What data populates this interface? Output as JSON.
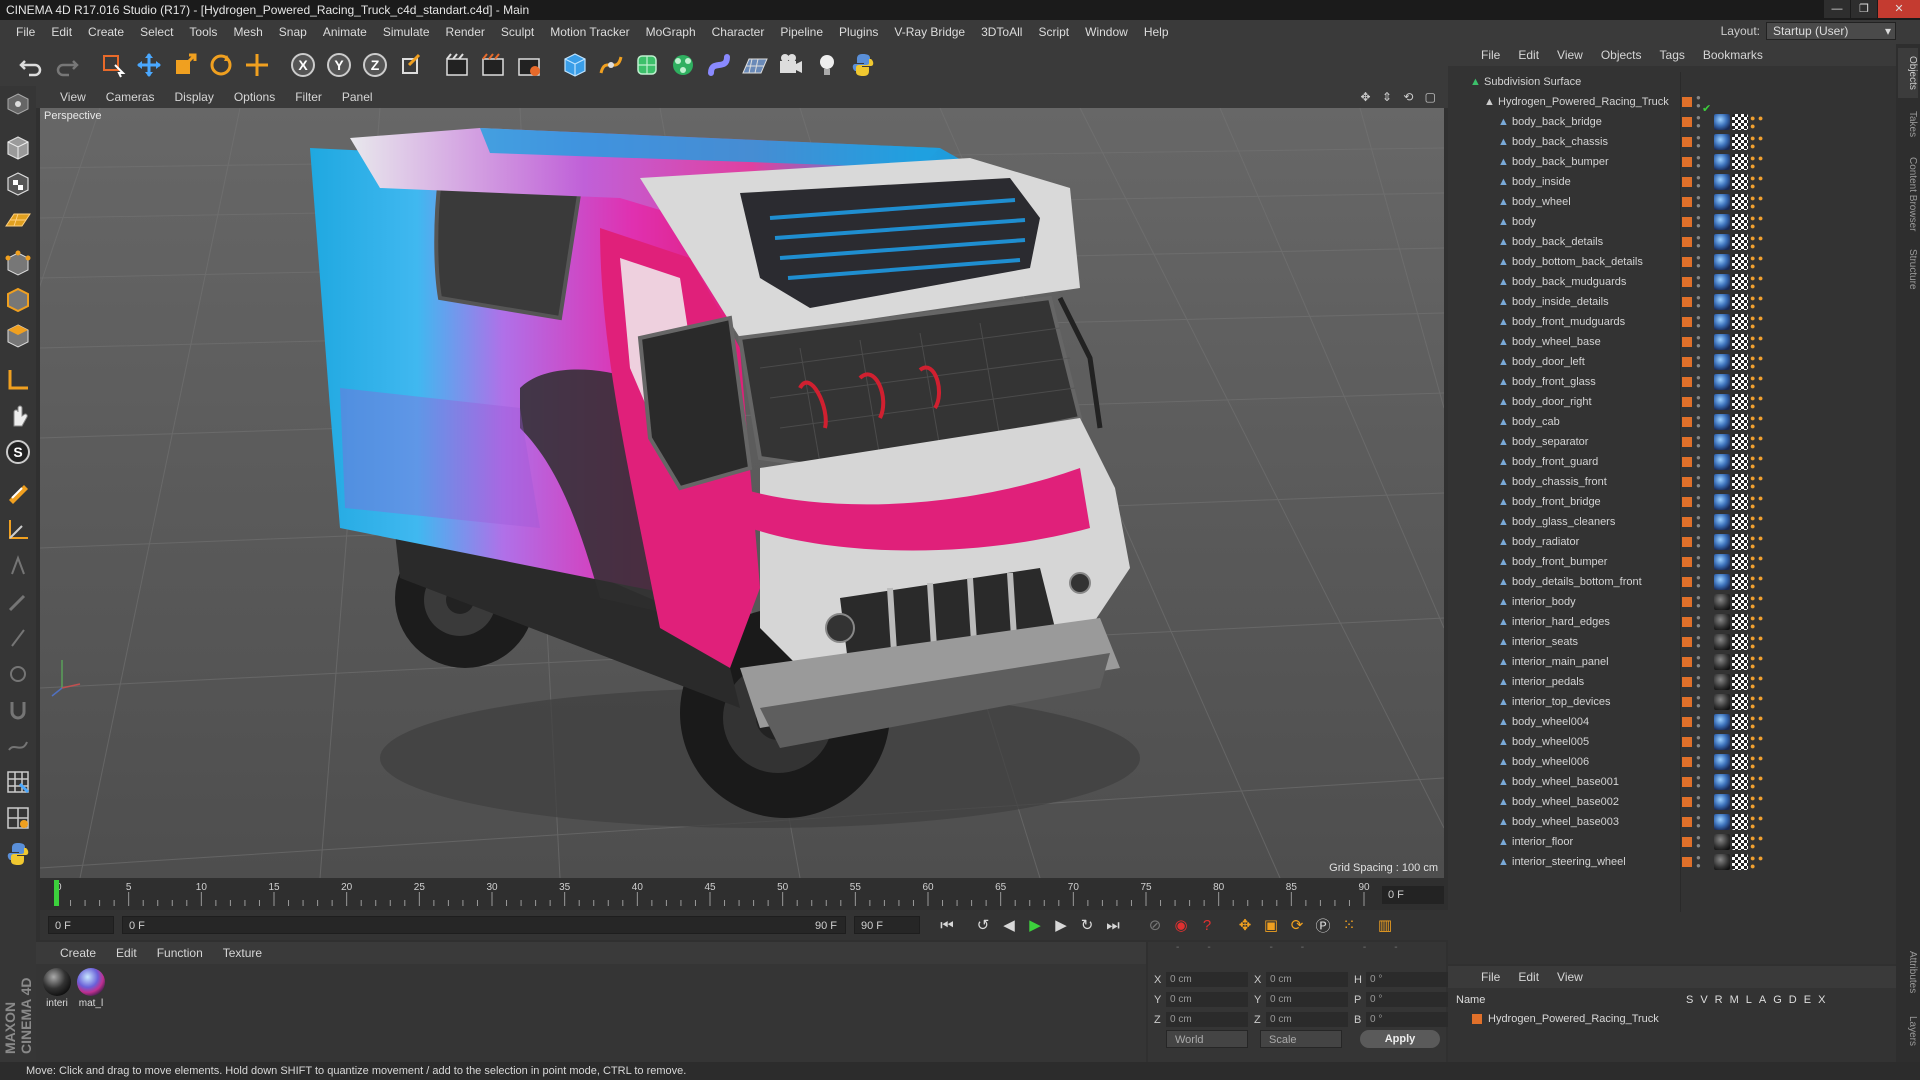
{
  "app": {
    "title": "CINEMA 4D R17.016 Studio (R17) - [Hydrogen_Powered_Racing_Truck_c4d_standart.c4d] - Main"
  },
  "menu": [
    "File",
    "Edit",
    "Create",
    "Select",
    "Tools",
    "Mesh",
    "Snap",
    "Animate",
    "Simulate",
    "Render",
    "Sculpt",
    "Motion Tracker",
    "MoGraph",
    "Character",
    "Pipeline",
    "Plugins",
    "V-Ray Bridge",
    "3DToAll",
    "Script",
    "Window",
    "Help"
  ],
  "layout": {
    "label": "Layout:",
    "value": "Startup (User)"
  },
  "viewport": {
    "menu": [
      "View",
      "Cameras",
      "Display",
      "Options",
      "Filter",
      "Panel"
    ],
    "label": "Perspective",
    "grid_spacing": "Grid Spacing : 100 cm"
  },
  "timeline": {
    "ticks": [
      "0",
      "5",
      "10",
      "15",
      "20",
      "25",
      "30",
      "35",
      "40",
      "45",
      "50",
      "55",
      "60",
      "65",
      "70",
      "75",
      "80",
      "85",
      "90"
    ],
    "end_frame_display": "0 F"
  },
  "transport": {
    "current": "0 F",
    "range_start": "0 F",
    "range_end": "90 F",
    "max": "90 F"
  },
  "materials": {
    "menu": [
      "Create",
      "Edit",
      "Function",
      "Texture"
    ],
    "items": [
      {
        "label": "interi"
      },
      {
        "label": "mat_l"
      }
    ]
  },
  "coords": {
    "header": "-- -- --",
    "rows": [
      {
        "a": "X",
        "av": "0 cm",
        "b": "X",
        "bv": "0 cm",
        "c": "H",
        "cv": "0 °"
      },
      {
        "a": "Y",
        "av": "0 cm",
        "b": "Y",
        "bv": "0 cm",
        "c": "P",
        "cv": "0 °"
      },
      {
        "a": "Z",
        "av": "0 cm",
        "b": "Z",
        "bv": "0 cm",
        "c": "B",
        "cv": "0 °"
      }
    ],
    "space": "World",
    "mode": "Scale",
    "apply": "Apply"
  },
  "status": "Move: Click and drag to move elements. Hold down SHIFT to quantize movement / add to the selection in point mode, CTRL to remove.",
  "objects": {
    "menu": [
      "File",
      "Edit",
      "View",
      "Objects",
      "Tags",
      "Bookmarks"
    ],
    "root": "Subdivision Surface",
    "group": "Hydrogen_Powered_Racing_Truck",
    "children": [
      {
        "name": "body_back_bridge",
        "mat": "mat1"
      },
      {
        "name": "body_back_chassis",
        "mat": "mat1"
      },
      {
        "name": "body_back_bumper",
        "mat": "mat1"
      },
      {
        "name": "body_inside",
        "mat": "mat1"
      },
      {
        "name": "body_wheel",
        "mat": "mat1"
      },
      {
        "name": "body",
        "mat": "mat1"
      },
      {
        "name": "body_back_details",
        "mat": "mat1"
      },
      {
        "name": "body_bottom_back_details",
        "mat": "mat1"
      },
      {
        "name": "body_back_mudguards",
        "mat": "mat1"
      },
      {
        "name": "body_inside_details",
        "mat": "mat1"
      },
      {
        "name": "body_front_mudguards",
        "mat": "mat1"
      },
      {
        "name": "body_wheel_base",
        "mat": "mat1"
      },
      {
        "name": "body_door_left",
        "mat": "mat1"
      },
      {
        "name": "body_front_glass",
        "mat": "mat1"
      },
      {
        "name": "body_door_right",
        "mat": "mat1"
      },
      {
        "name": "body_cab",
        "mat": "mat1"
      },
      {
        "name": "body_separator",
        "mat": "mat1"
      },
      {
        "name": "body_front_guard",
        "mat": "mat1"
      },
      {
        "name": "body_chassis_front",
        "mat": "mat1"
      },
      {
        "name": "body_front_bridge",
        "mat": "mat1"
      },
      {
        "name": "body_glass_cleaners",
        "mat": "mat1"
      },
      {
        "name": "body_radiator",
        "mat": "mat1"
      },
      {
        "name": "body_front_bumper",
        "mat": "mat1"
      },
      {
        "name": "body_details_bottom_front",
        "mat": "mat1"
      },
      {
        "name": "interior_body",
        "mat": "mat2"
      },
      {
        "name": "interior_hard_edges",
        "mat": "mat2"
      },
      {
        "name": "interior_seats",
        "mat": "mat2"
      },
      {
        "name": "interior_main_panel",
        "mat": "mat2"
      },
      {
        "name": "interior_pedals",
        "mat": "mat2"
      },
      {
        "name": "interior_top_devices",
        "mat": "mat2"
      },
      {
        "name": "body_wheel004",
        "mat": "mat1"
      },
      {
        "name": "body_wheel005",
        "mat": "mat1"
      },
      {
        "name": "body_wheel006",
        "mat": "mat1"
      },
      {
        "name": "body_wheel_base001",
        "mat": "mat1"
      },
      {
        "name": "body_wheel_base002",
        "mat": "mat1"
      },
      {
        "name": "body_wheel_base003",
        "mat": "mat1"
      },
      {
        "name": "interior_floor",
        "mat": "mat2"
      },
      {
        "name": "interior_steering_wheel",
        "mat": "mat2"
      }
    ]
  },
  "layers": {
    "menu": [
      "File",
      "Edit",
      "View"
    ],
    "col_name": "Name",
    "cols": "SVRMLAGDEX",
    "row": "Hydrogen_Powered_Racing_Truck"
  },
  "right_tabs": [
    "Objects",
    "Takes",
    "Content Browser",
    "Structure",
    "Attributes",
    "Layers"
  ],
  "maxon": "MAXON CINEMA 4D",
  "colors": {
    "accent_orange": "#e0702a",
    "truck_pink": "#e0207a",
    "truck_cyan": "#1fa8e0"
  }
}
